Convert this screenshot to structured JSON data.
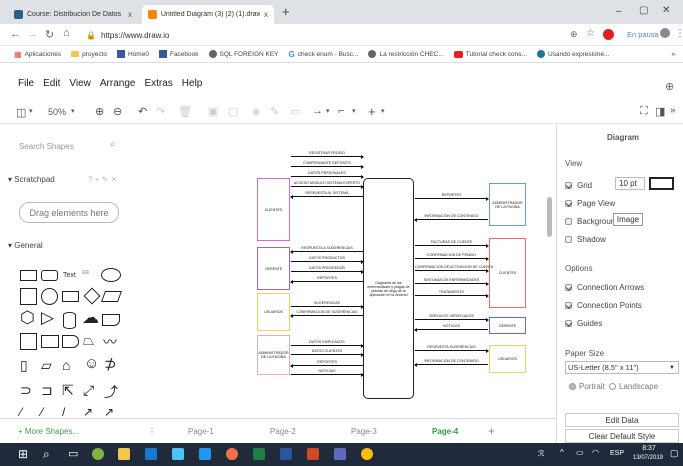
{
  "browser": {
    "tabs": [
      {
        "label": "Course: Distribucion De Datos",
        "close": "x",
        "favicon_color": "#2d5f8b"
      },
      {
        "label": "Untitled Diagram (3) (2) (1).draw",
        "close": "x",
        "favicon_color": "#f08705"
      }
    ],
    "new_tab": "+",
    "window_controls": [
      "–",
      "▢",
      "✕"
    ],
    "url": "https://www.draw.io",
    "paused_label": "En pausa",
    "bookmarks": [
      {
        "label": "Aplicaciones",
        "icon": "apps-icon"
      },
      {
        "label": "proyecto",
        "icon": "folder-icon"
      },
      {
        "label": "Home0",
        "icon": "facebook-icon"
      },
      {
        "label": "Facebook",
        "icon": "facebook-icon"
      },
      {
        "label": "SQL FOREIGN KEY",
        "icon": "globe-icon"
      },
      {
        "label": "check enum - Busc...",
        "icon": "google-icon"
      },
      {
        "label": "La restricción CHEC...",
        "icon": "globe-icon"
      },
      {
        "label": "Tutorial check cons...",
        "icon": "youtube-icon"
      },
      {
        "label": "Usando expresione...",
        "icon": "wp-icon"
      }
    ],
    "more": "»"
  },
  "menu": [
    "File",
    "Edit",
    "View",
    "Arrange",
    "Extras",
    "Help"
  ],
  "toolbar": {
    "zoom": "50%"
  },
  "left": {
    "search_placeholder": "Search Shapes",
    "scratchpad": "Scratchpad",
    "drag_here": "Drag elements here",
    "general": "General",
    "text_shape": "Text",
    "more_shapes": "+ More Shapes..."
  },
  "right": {
    "title": "Diagram",
    "view_heading": "View",
    "grid": "Grid",
    "grid_size": "10 pt",
    "page_view": "Page View",
    "background": "Background",
    "image_button": "Image",
    "shadow": "Shadow",
    "options_heading": "Options",
    "connection_arrows": "Connection Arrows",
    "connection_points": "Connection Points",
    "guides": "Guides",
    "paper_size_heading": "Paper Size",
    "paper_size": "US-Letter (8,5\" x 11\")",
    "portrait": "Portrait",
    "landscape": "Landscape",
    "edit_data": "Edit Data",
    "clear_default_style": "Clear Default Style"
  },
  "pages": [
    "Page-1",
    "Page-2",
    "Page-3",
    "Page-4"
  ],
  "add_page": "+",
  "diagram": {
    "center": "Diagrama de las enfermedades y plagas de plantas de riego de la aplicación en la Android",
    "left_entities": [
      {
        "label": "CLIENTES",
        "color": "#d966d9"
      },
      {
        "label": "GERENTE",
        "color": "#9966cc"
      },
      {
        "label": "USUARIOS",
        "color": "#f0d060"
      },
      {
        "label": "ADMINISTRADOR DE LA PAGINA",
        "color": "#e6b0b0"
      }
    ],
    "right_entities": [
      {
        "label": "ADMINISTRADOR DE LA PAGINA",
        "color": "#6699ff"
      },
      {
        "label": "CLIENTES",
        "color": "#ff6666"
      },
      {
        "label": "GERENTE",
        "color": "#6666ff"
      },
      {
        "label": "USUARIOS",
        "color": "#f0d060"
      }
    ],
    "left_flows": [
      "REGISTRAR PEDIDO",
      "COMPROBANTE DEPOSITO",
      "DATOS PERSONALES",
      "ACCESO MODULO SISTEMA EXPERTO",
      "RESPUESTA AL SISTEMA",
      "RESPUESTA A SUGERENCIAS",
      "DATOS PRODUCTOS",
      "DATOS PROVEEDOR",
      "REPORTES",
      "SUGERENCIAS",
      "CONFIRMACION DE SUGERENCIAS",
      "DATOS EMPLEADOS",
      "DATOS CLIENTES",
      "REPORTES",
      "NOTICIAS"
    ],
    "right_flows": [
      "REPORTES",
      "INFORMACION DE CONTENIDO",
      "FACTURAS DE CLIENTE",
      "CONFIRMACION DE PEDIDO",
      "CONFIRMACION DE ACTIVACION DE CUENTA",
      "SINTOMAS DE ENFERMEDADES",
      "TRATAMIENTO",
      "SERVICIOS VERIFICADOS",
      "NOTICIAS",
      "RESPUESTA SUGERENCIAS",
      "INFORMACION DE CONTENIDO"
    ]
  },
  "taskbar": {
    "lang": "ESP",
    "time": "8:37",
    "date": "13/07/2019"
  }
}
